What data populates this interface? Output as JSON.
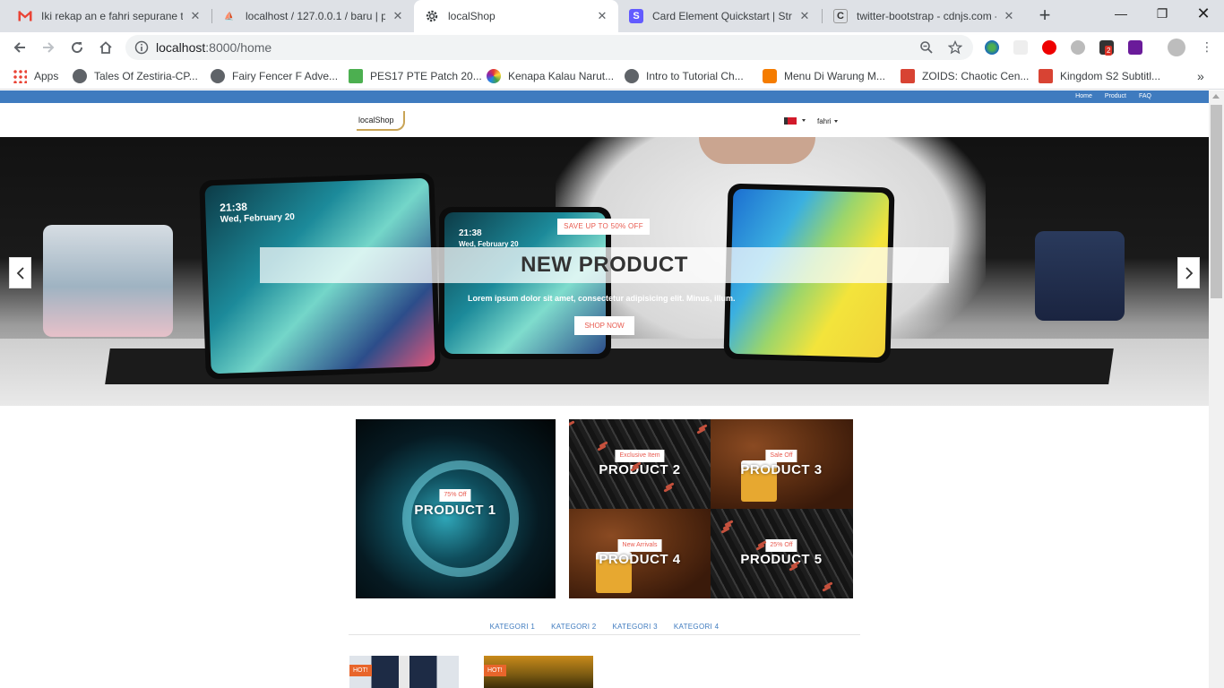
{
  "browser": {
    "tabs": [
      {
        "title": "Iki rekap an e fahri sepurane te",
        "icon": "gmail-icon",
        "active": false
      },
      {
        "title": "localhost / 127.0.0.1 / baru | ph",
        "icon": "phpmyadmin-icon",
        "active": false
      },
      {
        "title": "localShop",
        "icon": "gear-icon",
        "active": true
      },
      {
        "title": "Card Element Quickstart | Strip",
        "icon": "stripe-icon",
        "active": false
      },
      {
        "title": "twitter-bootstrap - cdnjs.com -",
        "icon": "cdnjs-icon",
        "active": false
      }
    ],
    "url_host": "localhost",
    "url_path": ":8000/home",
    "bookmarks": [
      {
        "label": "Apps",
        "icon": "apps-grid-icon"
      },
      {
        "label": "Tales Of Zestiria-CP...",
        "icon": "globe-icon"
      },
      {
        "label": "Fairy Fencer F Adve...",
        "icon": "globe-icon"
      },
      {
        "label": "PES17 PTE Patch 20...",
        "icon": "patch-icon"
      },
      {
        "label": "Kenapa Kalau Narut...",
        "icon": "colorful-ball-icon"
      },
      {
        "label": "Intro to Tutorial Ch...",
        "icon": "globe-icon"
      },
      {
        "label": "Menu Di Warung M...",
        "icon": "blogger-icon"
      },
      {
        "label": "ZOIDS: Chaotic Cen...",
        "icon": "play-arrow-icon"
      },
      {
        "label": "Kingdom S2 Subtitl...",
        "icon": "play-arrow-icon"
      }
    ],
    "extension_badge": "2"
  },
  "site": {
    "topnav": [
      "Home",
      "Product",
      "FAQ"
    ],
    "logo": "localShop",
    "user": "fahri",
    "hero": {
      "badge": "SAVE UP TO 50% OFF",
      "title": "NEW PRODUCT",
      "text": "Lorem ipsum dolor sit amet, consectetur adipisicing elit. Minus, illum.",
      "button": "SHOP NOW",
      "phone_time": "21:38",
      "phone_date": "Wed, February 20"
    },
    "products": [
      {
        "name": "PRODUCT 1",
        "badge": "75% Off"
      },
      {
        "name": "PRODUCT 2",
        "badge": "Exclusive Item"
      },
      {
        "name": "PRODUCT 3",
        "badge": "Sale Off"
      },
      {
        "name": "PRODUCT 4",
        "badge": "New Arrivals"
      },
      {
        "name": "PRODUCT 5",
        "badge": "25% Off"
      }
    ],
    "categories": [
      "KATEGORI 1",
      "KATEGORI 2",
      "KATEGORI 3",
      "KATEGORI 4"
    ],
    "hot_label": "HOT!"
  },
  "colors": {
    "accent_blue": "#3f7bbf",
    "badge_red": "#e85a4f",
    "hot_orange": "#e8652b",
    "logo_gold": "#c9a456"
  }
}
